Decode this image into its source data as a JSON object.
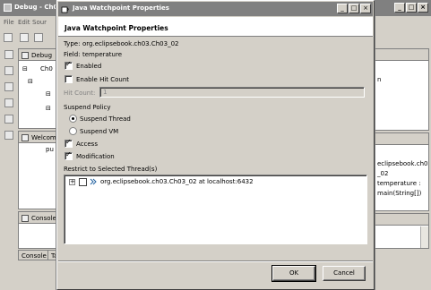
{
  "background_window": {
    "title": "Debug - Ch0",
    "menu": [
      "File",
      "Edit",
      "Sour"
    ],
    "debug_view_label": "Debug",
    "tree_root": "Ch0",
    "welcome_label": "Welcom",
    "editor_text": "pu",
    "console_label": "Console",
    "bottom_tabs": [
      "Console",
      "Ta"
    ],
    "right_lines": [
      "eclipsebook.ch0",
      "_02",
      "temperature :",
      "main(String[])"
    ],
    "right_top_text": "n"
  },
  "dialog": {
    "title": "Java Watchpoint Properties",
    "header": "Java Watchpoint Properties",
    "type_label": "Type:",
    "type_value": "org.eclipsebook.ch03.Ch03_02",
    "field_label": "Field:",
    "field_value": "temperature",
    "enabled_label": "Enabled",
    "enabled_checked": true,
    "enable_hit_count_label": "Enable Hit Count",
    "enable_hit_count_checked": false,
    "hit_count_label": "Hit Count:",
    "hit_count_value": "1",
    "suspend_policy_label": "Suspend Policy",
    "suspend_thread_label": "Suspend Thread",
    "suspend_vm_label": "Suspend VM",
    "suspend_selected": "thread",
    "access_label": "Access",
    "access_checked": true,
    "modification_label": "Modification",
    "modification_checked": true,
    "restrict_label": "Restrict to Selected Thread(s)",
    "thread_item": "org.eclipsebook.ch03.Ch03_02 at localhost:6432",
    "ok_label": "OK",
    "cancel_label": "Cancel",
    "title_controls": [
      "_",
      "□",
      "×"
    ]
  }
}
